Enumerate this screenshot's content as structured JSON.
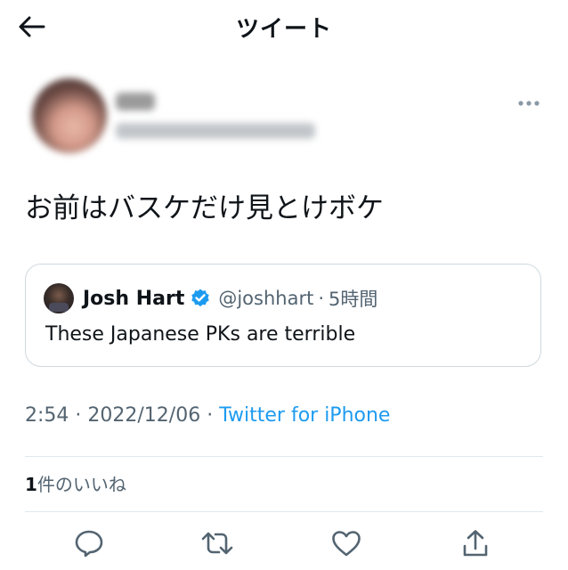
{
  "header": {
    "title": "ツイート"
  },
  "tweet": {
    "text": "お前はバスケだけ見とけボケ",
    "quote": {
      "name": "Josh Hart",
      "handle": "@joshhart",
      "separator": "·",
      "time": "5時間",
      "text": "These Japanese PKs are terrible"
    },
    "meta": {
      "time": "2:54",
      "separator": "·",
      "date": "2022/12/06",
      "source": "Twitter for iPhone"
    },
    "likes": {
      "count": "1",
      "label": "件のいいね"
    }
  },
  "icons": {
    "back": "arrow-left-icon",
    "more": "more-horizontal-icon",
    "verified": "verified-badge-icon",
    "reply": "reply-icon",
    "retweet": "retweet-icon",
    "like": "heart-icon",
    "share": "share-icon"
  },
  "colors": {
    "text": "#0f1419",
    "secondary": "#536471",
    "accent": "#1d9bf0",
    "border": "#cfd9de"
  }
}
